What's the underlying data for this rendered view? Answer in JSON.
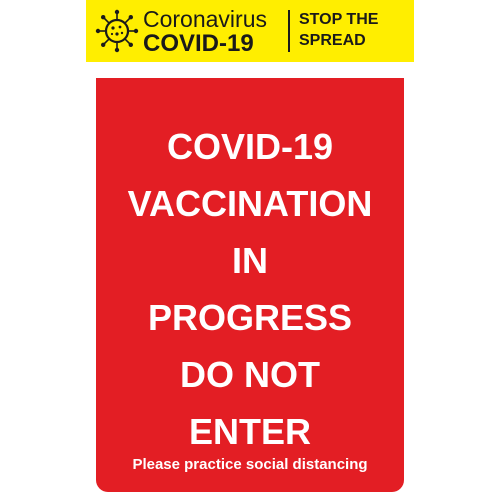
{
  "header": {
    "brand_line1": "Coronavirus",
    "brand_line2": "COVID-19",
    "slogan_line1": "STOP THE",
    "slogan_line2": "SPREAD",
    "icon": "virus-icon",
    "background_color": "#ffee00"
  },
  "panel": {
    "background_color": "#e31e24",
    "message_lines": [
      "COVID-19",
      "VACCINATION",
      "IN",
      "PROGRESS",
      "DO NOT",
      "ENTER"
    ],
    "footer_note": "Please practice social distancing"
  }
}
